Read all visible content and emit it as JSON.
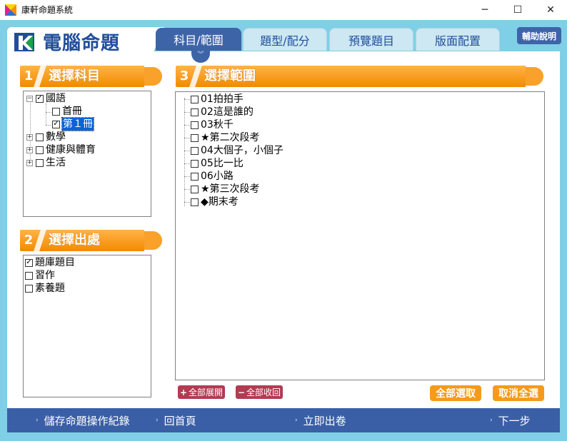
{
  "window": {
    "title": "康軒命題系統",
    "minimize": "─",
    "maximize": "☐",
    "close": "✕"
  },
  "brand": {
    "name": "電腦命題"
  },
  "tabs": [
    {
      "label": "科目/範圍",
      "active": true
    },
    {
      "label": "題型/配分",
      "active": false
    },
    {
      "label": "預覽題目",
      "active": false
    },
    {
      "label": "版面配置",
      "active": false
    }
  ],
  "tab_arrow": "︾",
  "help": "輔助說明",
  "section1": {
    "number": "1",
    "title": "選擇科目",
    "tree": [
      {
        "label": "國語",
        "expander": "−",
        "checked": true
      },
      {
        "label": "首冊",
        "checked": false
      },
      {
        "label": "第１冊",
        "checked": true
      },
      {
        "label": "數學",
        "expander": "+",
        "checked": false
      },
      {
        "label": "健康與體育",
        "expander": "+",
        "checked": false
      },
      {
        "label": "生活",
        "expander": "+",
        "checked": false
      }
    ]
  },
  "section2": {
    "number": "2",
    "title": "選擇出處",
    "items": [
      {
        "label": "題庫題目",
        "checked": true
      },
      {
        "label": "習作",
        "checked": false
      },
      {
        "label": "素養題",
        "checked": false
      }
    ]
  },
  "section3": {
    "number": "3",
    "title": "選擇範圍",
    "items": [
      {
        "label": "01拍拍手",
        "checked": false
      },
      {
        "label": "02這是誰的",
        "checked": false
      },
      {
        "label": "03秋千",
        "checked": false
      },
      {
        "label": "★第二次段考",
        "checked": false
      },
      {
        "label": "04大個子，小個子",
        "checked": false
      },
      {
        "label": "05比一比",
        "checked": false
      },
      {
        "label": "06小路",
        "checked": false
      },
      {
        "label": "★第三次段考",
        "checked": false
      },
      {
        "label": "◆期末考",
        "checked": false
      }
    ]
  },
  "buttons": {
    "expand_all": "全部展開",
    "collapse_all": "全部收回",
    "expand_icon": "+",
    "collapse_icon": "−",
    "select_all": "全部選取",
    "deselect_all": "取消全選"
  },
  "footer": {
    "save_log": "儲存命題操作紀錄",
    "home": "回首頁",
    "print": "立即出卷",
    "next": "下一步",
    "caret": "›"
  },
  "colors": {
    "frame": "#7fcfe6",
    "accent_blue": "#3e64a8",
    "orange": "#f38a00",
    "button_red": "#b23b52"
  }
}
